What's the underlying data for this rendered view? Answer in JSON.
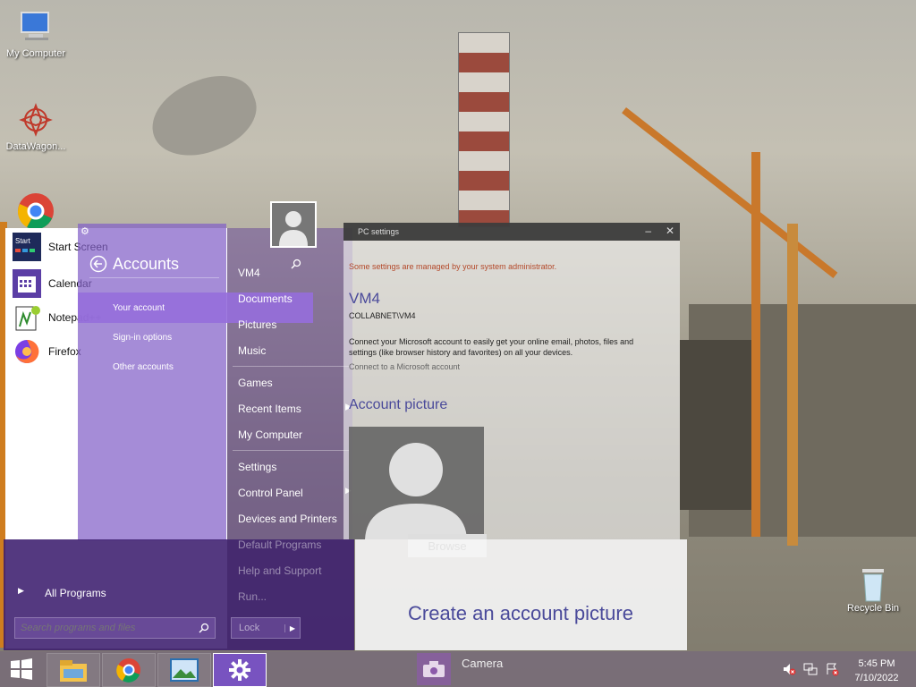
{
  "desktop": {
    "icons": [
      {
        "label": "My Computer",
        "icon": "computer-icon"
      },
      {
        "label": "DataWagon...",
        "icon": "datawagon-icon"
      },
      {
        "label": "Recycle Bin",
        "icon": "recycle-bin-icon"
      }
    ]
  },
  "start_menu": {
    "pinned": [
      {
        "label": "Start Screen",
        "icon": "start-screen-icon"
      },
      {
        "label": "Calendar",
        "icon": "calendar-icon"
      },
      {
        "label": "Notepad++",
        "icon": "notepadpp-icon"
      },
      {
        "label": "Firefox",
        "icon": "firefox-icon"
      }
    ],
    "all_programs": "All Programs",
    "search_placeholder": "Search programs and files",
    "user_label": "VM4",
    "right_links": [
      "Documents",
      "Pictures",
      "Music",
      "Games",
      "Recent Items",
      "My Computer",
      "Settings",
      "Control Panel",
      "Devices and Printers",
      "Default Programs",
      "Help and Support",
      "Run..."
    ],
    "lock_label": "Lock"
  },
  "accounts_panel": {
    "title": "Accounts",
    "items": [
      "Your account",
      "Sign-in options",
      "Other accounts"
    ]
  },
  "pc_settings": {
    "window_title": "PC settings",
    "admin_notice": "Some settings are managed by your system administrator.",
    "account_name": "VM4",
    "account_domain": "COLLABNET\\VM4",
    "description": "Connect your Microsoft account to easily get your online email, photos, files and settings (like browser history and favorites) on all your devices.",
    "connect_link": "Connect to a Microsoft account",
    "picture_heading": "Account picture",
    "browse_label": "Browse",
    "create_heading": "Create an account picture",
    "camera_label": "Camera"
  },
  "taskbar": {
    "apps": [
      "windows-start-icon",
      "file-explorer-icon",
      "chrome-icon",
      "photos-icon",
      "settings-gear-icon"
    ],
    "time": "5:45 PM",
    "date": "7/10/2022"
  },
  "colors": {
    "accent_purple": "#8a5cc8",
    "admin_notice": "#b4492a",
    "taskbar": "#786c78"
  }
}
